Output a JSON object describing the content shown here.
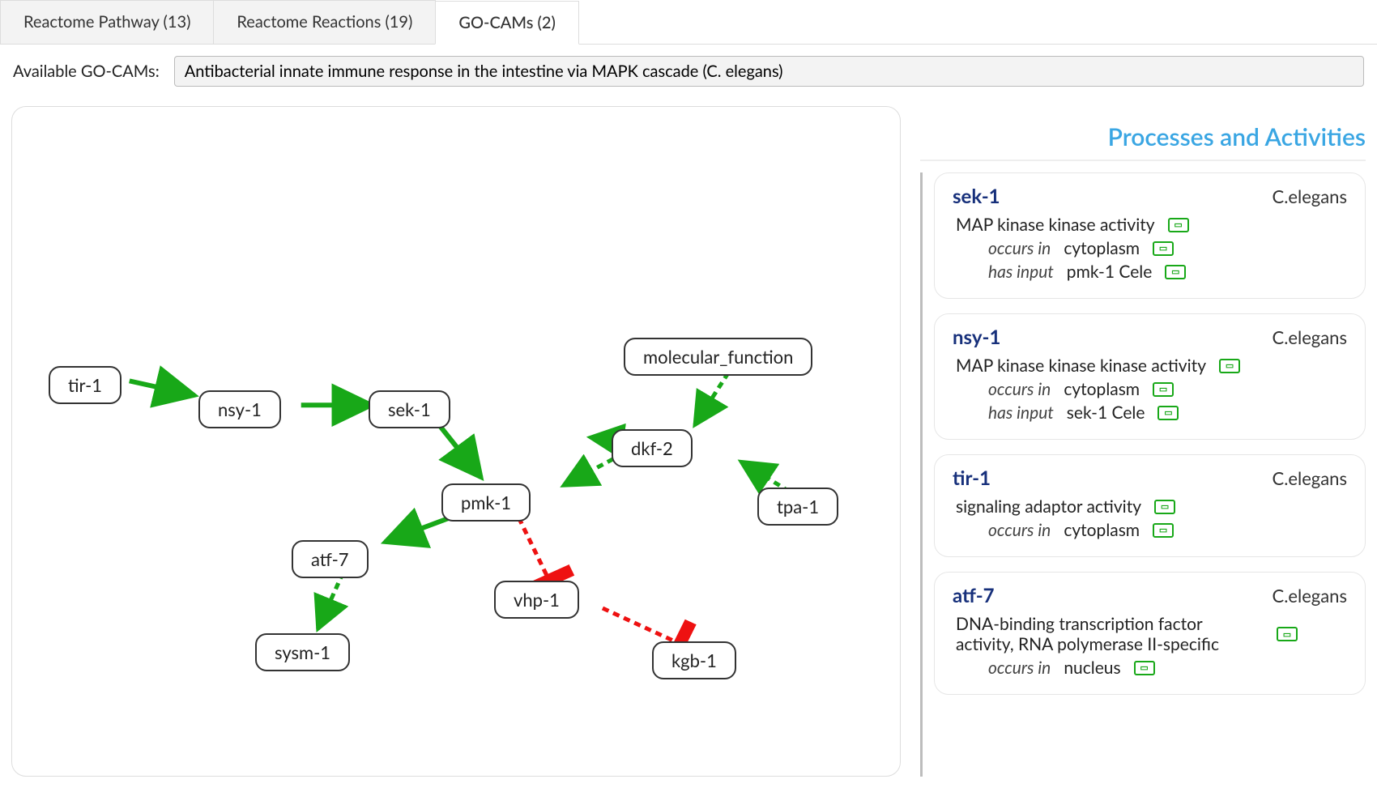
{
  "tabs": [
    {
      "label": "Reactome Pathway (13)",
      "active": false
    },
    {
      "label": "Reactome Reactions (19)",
      "active": false
    },
    {
      "label": "GO-CAMs (2)",
      "active": true
    }
  ],
  "selector": {
    "label": "Available GO-CAMs:",
    "value": "Antibacterial innate immune response in the intestine via MAPK cascade (C. elegans)"
  },
  "side": {
    "title": "Processes and Activities",
    "cards": [
      {
        "gene": "sek-1",
        "species": "C.elegans",
        "activity": "MAP kinase kinase activity",
        "rels": [
          {
            "rel": "occurs in",
            "val": "cytoplasm"
          },
          {
            "rel": "has input",
            "val": "pmk-1 Cele"
          }
        ]
      },
      {
        "gene": "nsy-1",
        "species": "C.elegans",
        "activity": "MAP kinase kinase kinase activity",
        "rels": [
          {
            "rel": "occurs in",
            "val": "cytoplasm"
          },
          {
            "rel": "has input",
            "val": "sek-1 Cele"
          }
        ]
      },
      {
        "gene": "tir-1",
        "species": "C.elegans",
        "activity": "signaling adaptor activity",
        "rels": [
          {
            "rel": "occurs in",
            "val": "cytoplasm"
          }
        ]
      },
      {
        "gene": "atf-7",
        "species": "C.elegans",
        "activity": "DNA-binding transcription factor activity, RNA polymerase II-specific",
        "rels": [
          {
            "rel": "occurs in",
            "val": "nucleus"
          }
        ]
      }
    ]
  },
  "graph": {
    "nodes": {
      "tir1": "tir-1",
      "nsy1": "nsy-1",
      "sek1": "sek-1",
      "pmk1": "pmk-1",
      "atf7": "atf-7",
      "sysm1": "sysm-1",
      "vhp1": "vhp-1",
      "kgb1": "kgb-1",
      "dkf2": "dkf-2",
      "tpa1": "tpa-1",
      "molfn": "molecular_function"
    }
  }
}
